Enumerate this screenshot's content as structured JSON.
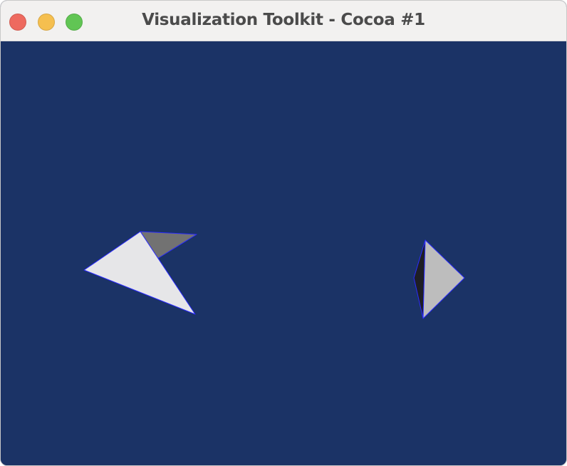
{
  "window": {
    "title": "Visualization Toolkit - Cocoa #1",
    "controls": [
      {
        "name": "close",
        "color": "#ee6a5f"
      },
      {
        "name": "minimize",
        "color": "#f5bf4f"
      },
      {
        "name": "zoom",
        "color": "#61c554"
      }
    ]
  },
  "render_view": {
    "background_color": "#1b3366",
    "edge_color": "#2a2aff",
    "object_colors": {
      "left_lit_face": "#e6e6e8",
      "left_shadow_face": "#727272",
      "right_lit_face": "#bdbdbd",
      "right_dark_face": "#1e1e24"
    }
  }
}
